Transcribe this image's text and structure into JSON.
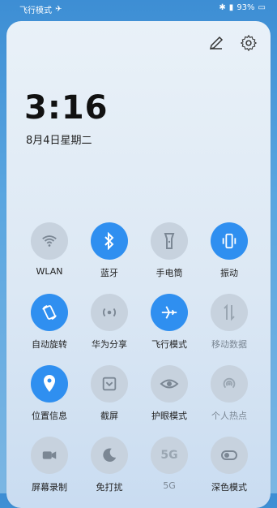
{
  "status": {
    "carrier_text": "飞行模式",
    "battery": "93%"
  },
  "panel": {
    "time": "3:16",
    "date": "8月4日星期二"
  },
  "toggles": [
    {
      "label": "WLAN",
      "icon": "wifi-icon",
      "state": "off"
    },
    {
      "label": "蓝牙",
      "icon": "bluetooth-icon",
      "state": "on"
    },
    {
      "label": "手电筒",
      "icon": "flashlight-icon",
      "state": "off"
    },
    {
      "label": "振动",
      "icon": "vibrate-icon",
      "state": "on"
    },
    {
      "label": "自动旋转",
      "icon": "rotate-icon",
      "state": "on"
    },
    {
      "label": "华为分享",
      "icon": "share-icon",
      "state": "off"
    },
    {
      "label": "飞行模式",
      "icon": "airplane-icon",
      "state": "on"
    },
    {
      "label": "移动数据",
      "icon": "data-icon",
      "state": "disabled"
    },
    {
      "label": "位置信息",
      "icon": "location-icon",
      "state": "on"
    },
    {
      "label": "截屏",
      "icon": "screenshot-icon",
      "state": "off"
    },
    {
      "label": "护眼模式",
      "icon": "eye-icon",
      "state": "off"
    },
    {
      "label": "个人热点",
      "icon": "hotspot-icon",
      "state": "disabled"
    },
    {
      "label": "屏幕录制",
      "icon": "record-icon",
      "state": "off"
    },
    {
      "label": "免打扰",
      "icon": "moon-icon",
      "state": "off"
    },
    {
      "label": "5G",
      "icon": "5g-icon",
      "state": "disabled"
    },
    {
      "label": "深色模式",
      "icon": "dark-mode-icon",
      "state": "off"
    }
  ],
  "colors": {
    "accent": "#2f8ff0"
  }
}
